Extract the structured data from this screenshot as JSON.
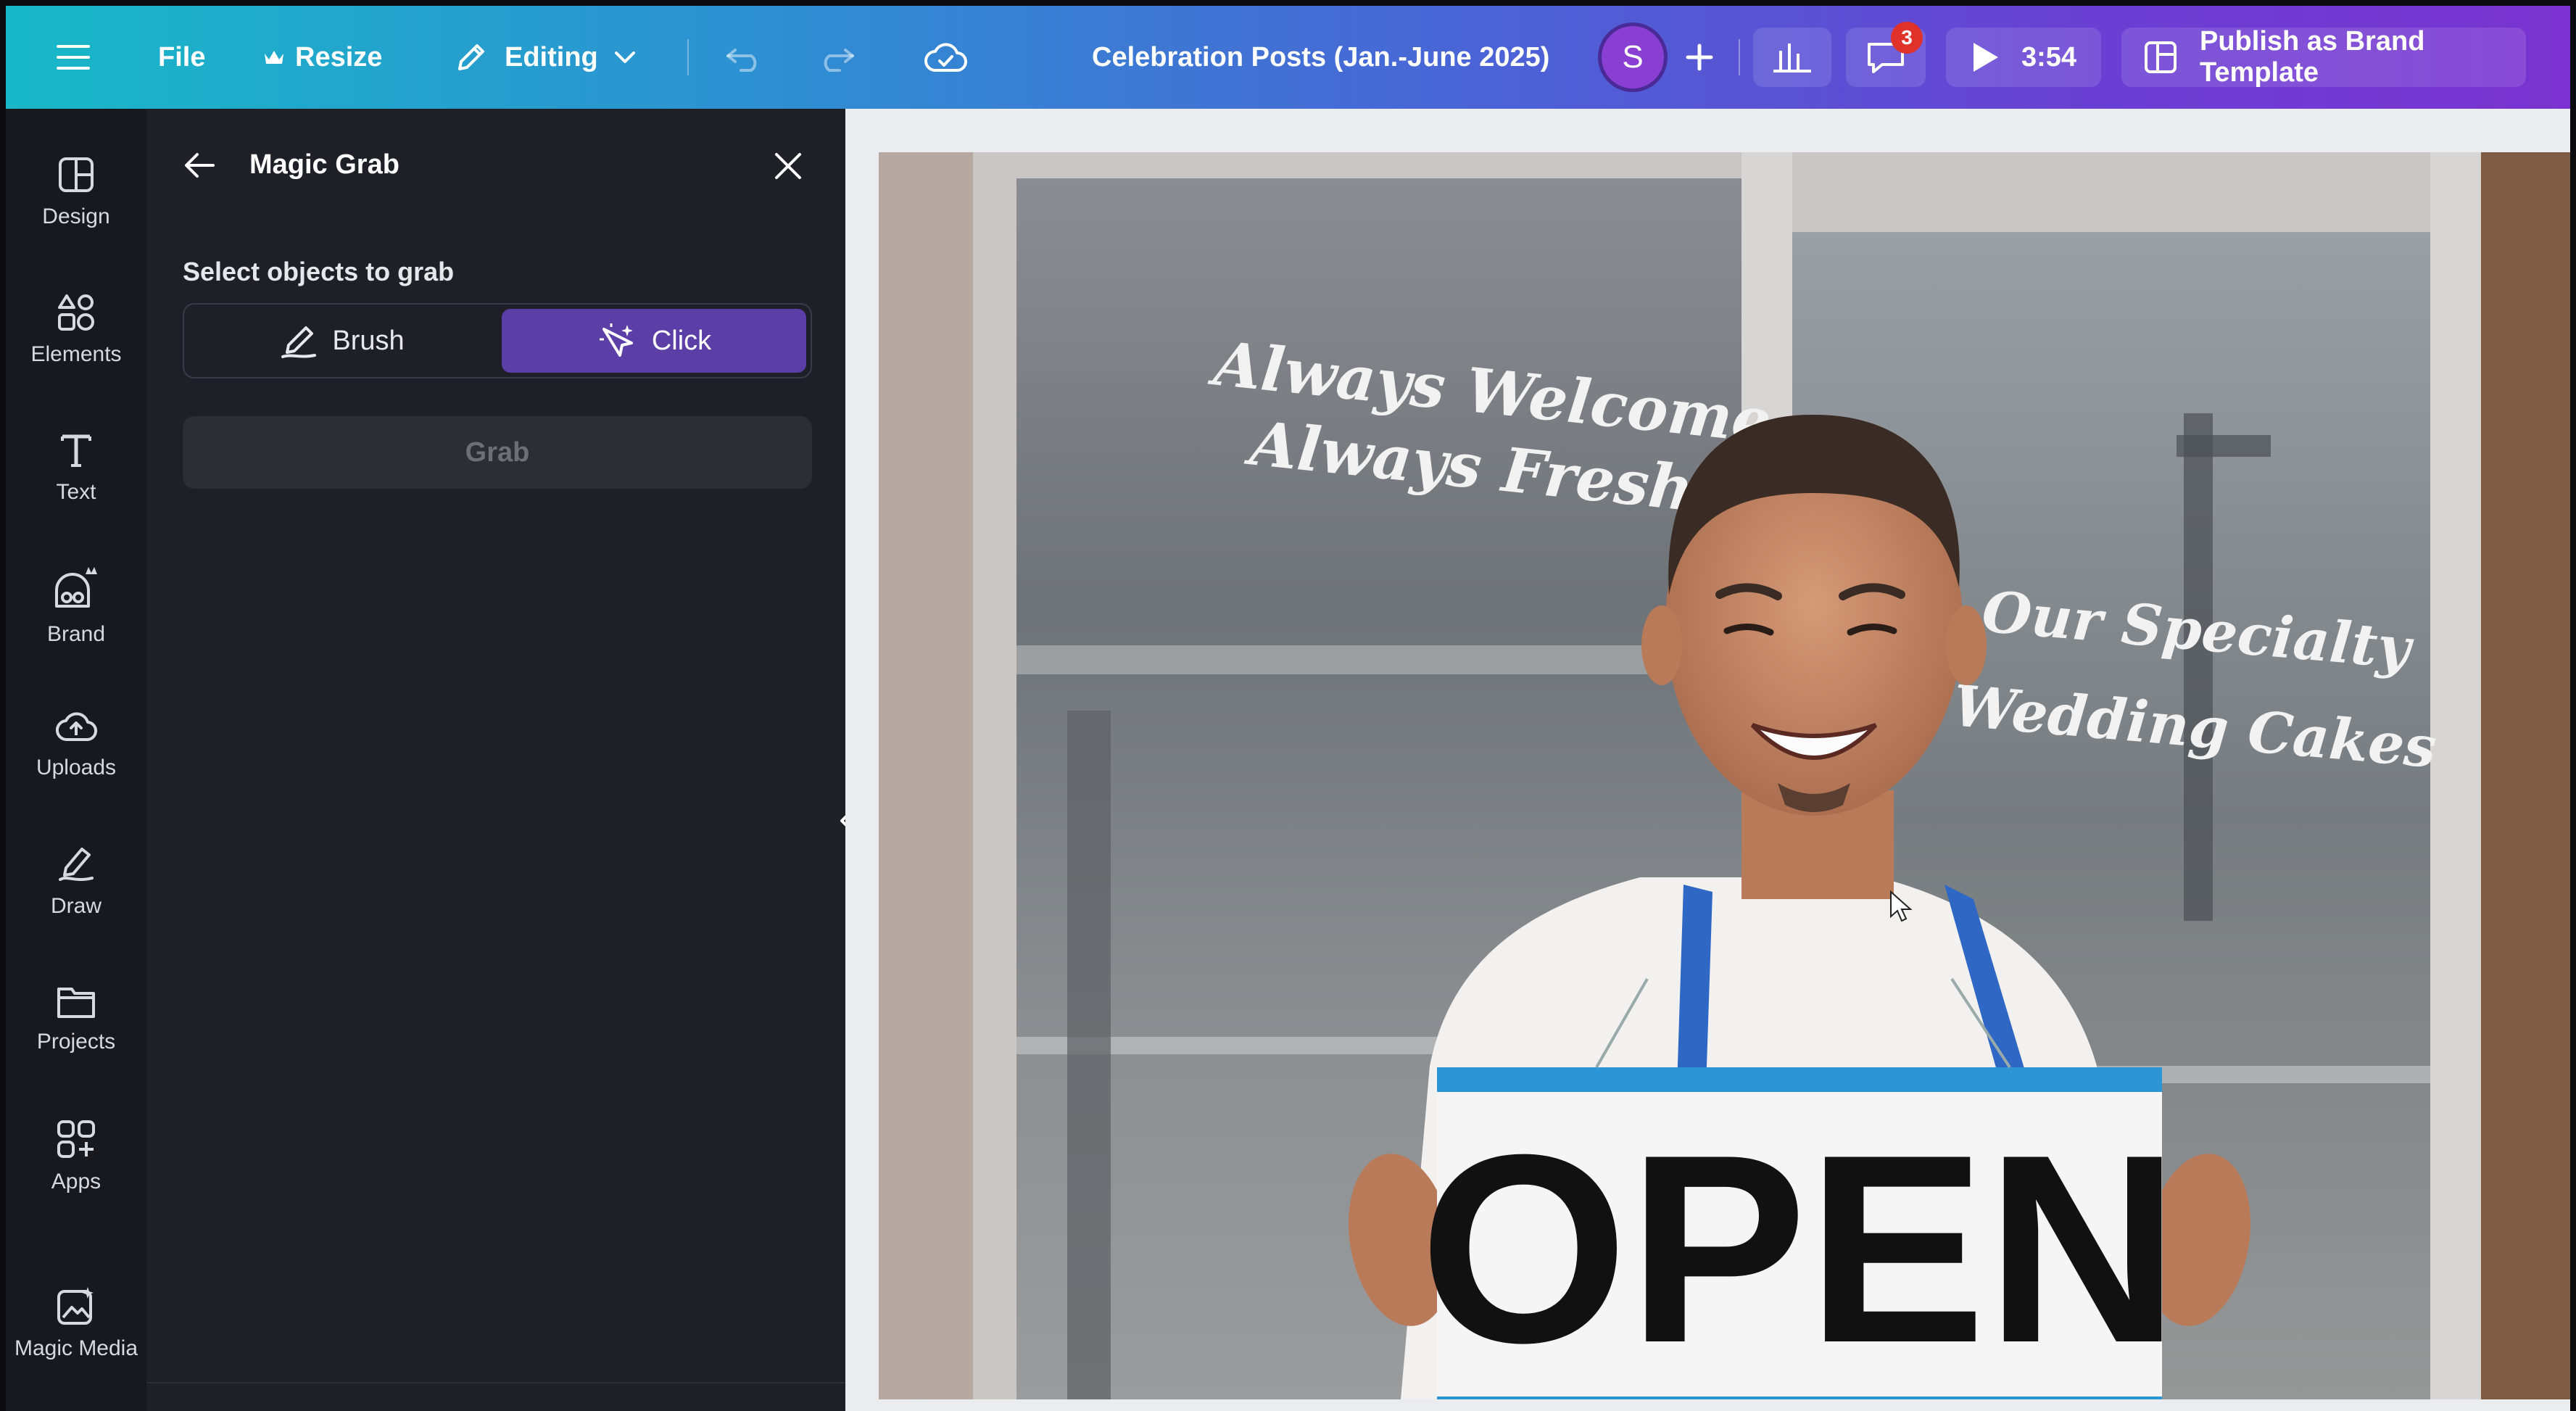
{
  "topbar": {
    "menu_icon": "hamburger-menu-icon",
    "file_label": "File",
    "resize_label": "Resize",
    "editing_label": "Editing",
    "design_title": "Celebration Posts (Jan.-June 2025)",
    "avatar_initial": "S",
    "notification_count": "3",
    "timer": "3:54",
    "publish_label": "Publish as Brand Template"
  },
  "rail": {
    "items": [
      {
        "label": "Design",
        "icon": "design-icon"
      },
      {
        "label": "Elements",
        "icon": "elements-icon"
      },
      {
        "label": "Text",
        "icon": "text-icon"
      },
      {
        "label": "Brand",
        "icon": "brand-icon"
      },
      {
        "label": "Uploads",
        "icon": "uploads-icon"
      },
      {
        "label": "Draw",
        "icon": "draw-icon"
      },
      {
        "label": "Projects",
        "icon": "projects-icon"
      },
      {
        "label": "Apps",
        "icon": "apps-icon"
      },
      {
        "label": "Magic Media",
        "icon": "magic-media-icon"
      }
    ]
  },
  "panel": {
    "title": "Magic Grab",
    "subtitle": "Select objects to grab",
    "modes": [
      {
        "label": "Brush",
        "active": false
      },
      {
        "label": "Click",
        "active": true
      }
    ],
    "grab_label": "Grab"
  },
  "canvas": {
    "photo_texts": {
      "window_line1": "Always Welcome",
      "window_line2": "Always Fresh",
      "window_right1": "Our Specialty",
      "window_right2": "Wedding Cakes",
      "sign": "OPEN"
    }
  },
  "colors": {
    "accent_purple": "#5b3fa6",
    "panel_bg": "#1f2027",
    "rail_bg": "#18191f",
    "badge_red": "#e0312b"
  }
}
